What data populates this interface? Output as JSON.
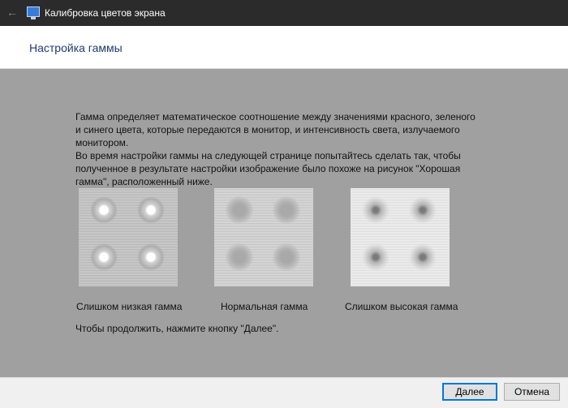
{
  "window": {
    "title": "Калибровка цветов экрана",
    "back_icon": "back-arrow-icon",
    "app_icon": "display-icon"
  },
  "header": {
    "title": "Настройка гаммы"
  },
  "content": {
    "description_1": "Гамма определяет математическое соотношение между значениями красного, зеленого и синего цвета, которые передаются в монитор, и интенсивность света, излучаемого монитором.",
    "description_2": "Во время настройки гаммы на следующей странице попытайтесь сделать так, чтобы полученное в результате настройки изображение было похоже на рисунок \"Хорошая гамма\", расположенный ниже.",
    "samples": [
      {
        "label": "Слишком низкая гамма"
      },
      {
        "label": "Нормальная гамма"
      },
      {
        "label": "Слишком высокая гамма"
      }
    ],
    "continue_hint": "Чтобы продолжить, нажмите кнопку \"Далее\"."
  },
  "buttons": {
    "next": "Далее",
    "cancel": "Отмена"
  },
  "colors": {
    "titlebar": "#2b2b2b",
    "body": "#a0a0a0",
    "heading": "#1e3b70",
    "focus": "#0078d7"
  }
}
